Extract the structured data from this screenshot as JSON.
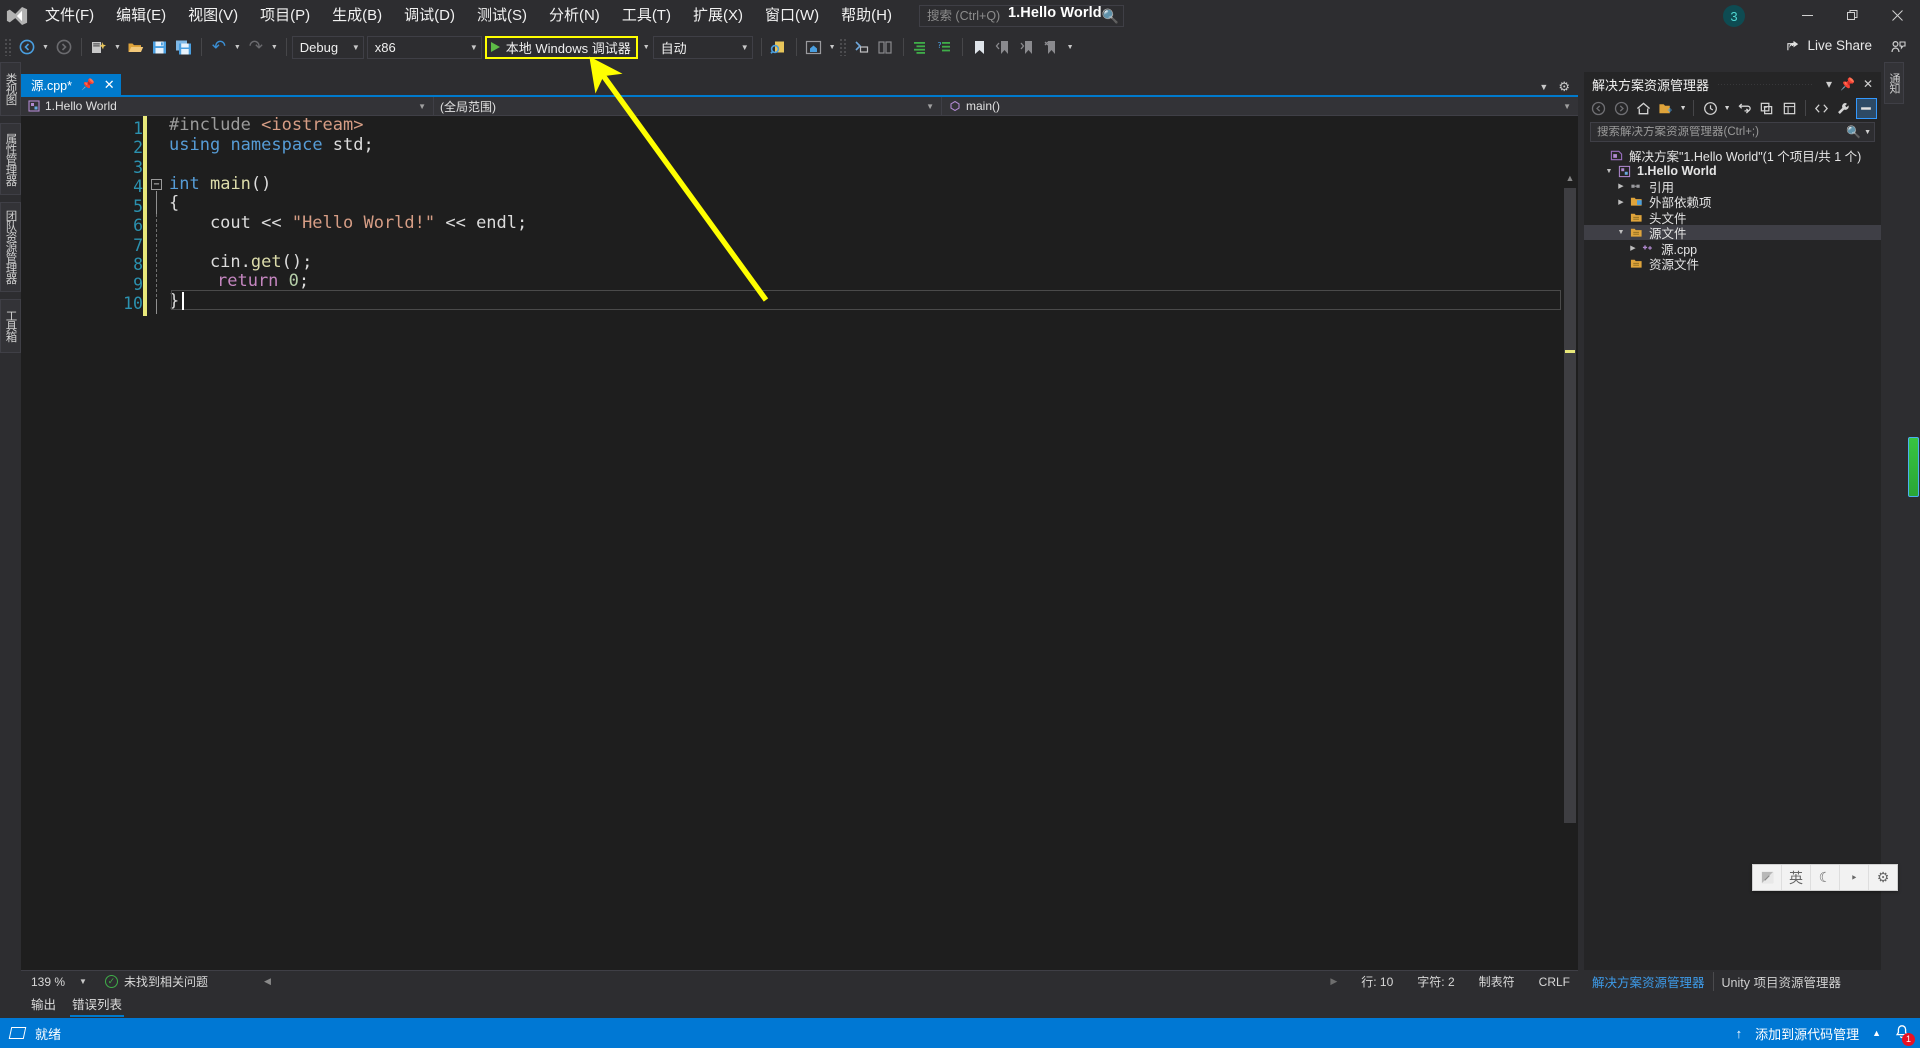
{
  "titlebar": {
    "menu": [
      {
        "label": "文件(F)"
      },
      {
        "label": "编辑(E)"
      },
      {
        "label": "视图(V)"
      },
      {
        "label": "项目(P)"
      },
      {
        "label": "生成(B)"
      },
      {
        "label": "调试(D)"
      },
      {
        "label": "测试(S)"
      },
      {
        "label": "分析(N)"
      },
      {
        "label": "工具(T)"
      },
      {
        "label": "扩展(X)"
      },
      {
        "label": "窗口(W)"
      },
      {
        "label": "帮助(H)"
      }
    ],
    "search_placeholder": "搜索 (Ctrl+Q)",
    "window_title": "1.Hello World",
    "account_badge": "3",
    "minimize": "—",
    "maximize": "❐",
    "close": "✕"
  },
  "toolbar": {
    "nav_back": "◀",
    "nav_forward": "▶",
    "new_project": "new-project",
    "open": "open",
    "save": "save",
    "save_all": "save-all",
    "undo": "↺",
    "redo": "↻",
    "config_value": "Debug",
    "platform_value": "x86",
    "run_label": "本地 Windows 调试器",
    "attach_value": "自动",
    "live_share": "Live Share"
  },
  "left_rail": [
    {
      "label": "类视图"
    },
    {
      "label": "属性管理器"
    },
    {
      "label": "团队资源管理器"
    },
    {
      "label": "工具箱"
    }
  ],
  "editor": {
    "tab_label": "源.cpp*",
    "pin_icon": "pin-icon",
    "close_icon": "✕",
    "nav_project": "1.Hello World",
    "nav_scope": "(全局范围)",
    "nav_member": "main()",
    "lines": [
      {
        "n": 1,
        "tokens": [
          {
            "t": "#include ",
            "c": "pre"
          },
          {
            "t": "<iostream>",
            "c": "str"
          }
        ]
      },
      {
        "n": 2,
        "tokens": [
          {
            "t": "using",
            "c": "kw"
          },
          {
            "t": " ",
            "c": "pl"
          },
          {
            "t": "namespace",
            "c": "kw"
          },
          {
            "t": " std;",
            "c": "pl"
          }
        ]
      },
      {
        "n": 3,
        "tokens": []
      },
      {
        "n": 4,
        "tokens": [
          {
            "t": "int",
            "c": "kw2"
          },
          {
            "t": " ",
            "c": "pl"
          },
          {
            "t": "main",
            "c": "fn"
          },
          {
            "t": "()",
            "c": "pl"
          }
        ]
      },
      {
        "n": 5,
        "tokens": [
          {
            "t": "{",
            "c": "pl"
          }
        ]
      },
      {
        "n": 6,
        "tokens": [
          {
            "t": "    cout ",
            "c": "pl"
          },
          {
            "t": "<<",
            "c": "pl"
          },
          {
            "t": " ",
            "c": "pl"
          },
          {
            "t": "\"Hello World!\"",
            "c": "str2"
          },
          {
            "t": " << endl;",
            "c": "pl"
          }
        ]
      },
      {
        "n": 7,
        "tokens": []
      },
      {
        "n": 8,
        "tokens": [
          {
            "t": "    cin.",
            "c": "pl"
          },
          {
            "t": "get",
            "c": "fn"
          },
          {
            "t": "();",
            "c": "pl"
          }
        ]
      },
      {
        "n": 9,
        "tokens": [
          {
            "t": "    ",
            "c": "pl"
          },
          {
            "t": "return",
            "c": "kw"
          },
          {
            "t": " ",
            "c": "pl"
          },
          {
            "t": "0",
            "c": "num"
          },
          {
            "t": ";",
            "c": "pl"
          }
        ]
      },
      {
        "n": 10,
        "tokens": [
          {
            "t": "}",
            "c": "pl"
          }
        ]
      }
    ],
    "fold_glyph": "−"
  },
  "editor_status": {
    "zoom": "139 %",
    "issues": "未找到相关问题",
    "line": "行: 10",
    "char": "字符: 2",
    "tabs_mode": "制表符",
    "eol": "CRLF"
  },
  "bottom_tabs": [
    {
      "label": "输出",
      "active": false
    },
    {
      "label": "错误列表",
      "active": true
    }
  ],
  "solution_explorer": {
    "title": "解决方案资源管理器",
    "menu_icon": "▾",
    "pin_icon": "pin-icon",
    "close_icon": "✕",
    "toolbar_icons": [
      "back-icon",
      "forward-icon",
      "home-icon",
      "show-all-files-icon",
      "pending-changes-icon",
      "refresh-icon",
      "collapse-all-icon",
      "properties-icon",
      "view-code-icon",
      "properties-window-icon",
      "preview-icon"
    ],
    "search_placeholder": "搜索解决方案资源管理器(Ctrl+;)",
    "tree": [
      {
        "depth": 0,
        "twisty": "",
        "icon": "solution-icon",
        "label": "解决方案\"1.Hello World\"(1 个项目/共 1 个)",
        "bold": false,
        "selected": false
      },
      {
        "depth": 1,
        "twisty": "▼",
        "icon": "project-icon",
        "label": "1.Hello World",
        "bold": true,
        "selected": false
      },
      {
        "depth": 2,
        "twisty": "▶",
        "icon": "references-icon",
        "label": "引用",
        "bold": false,
        "selected": false
      },
      {
        "depth": 2,
        "twisty": "▶",
        "icon": "external-deps-icon",
        "label": "外部依赖项",
        "bold": false,
        "selected": false
      },
      {
        "depth": 2,
        "twisty": "",
        "icon": "folder-icon",
        "label": "头文件",
        "bold": false,
        "selected": false
      },
      {
        "depth": 2,
        "twisty": "▼",
        "icon": "folder-icon",
        "label": "源文件",
        "bold": false,
        "selected": true
      },
      {
        "depth": 3,
        "twisty": "▶",
        "icon": "cpp-file-icon",
        "label": "源.cpp",
        "bold": false,
        "selected": false
      },
      {
        "depth": 2,
        "twisty": "",
        "icon": "folder-icon",
        "label": "资源文件",
        "bold": false,
        "selected": false
      }
    ],
    "bottom_tabs": [
      {
        "label": "解决方案资源管理器",
        "active": true
      },
      {
        "label": "Unity 项目资源管理器",
        "active": false
      }
    ]
  },
  "right_rail": [
    {
      "label": "通知"
    }
  ],
  "ime_bar": {
    "cells": [
      "mode-icon",
      "英",
      "moon-icon",
      "punctuation-icon",
      "gear-icon"
    ]
  },
  "taskbar": {
    "status": "就绪",
    "source_control": "添加到源代码管理",
    "up_arrow": "↑",
    "chevron": "▲",
    "notification_count": "1"
  },
  "annotation": {
    "arrow_color": "#ffff00",
    "highlight_color": "#ffff00",
    "description": "yellow arrow pointing to 本地 Windows 调试器 run button"
  },
  "colors": {
    "accent": "#007acc",
    "taskbar": "#0078d4",
    "editor_bg": "#1e1e1e",
    "chrome_bg": "#2d2d30",
    "panel_bg": "#252526"
  }
}
